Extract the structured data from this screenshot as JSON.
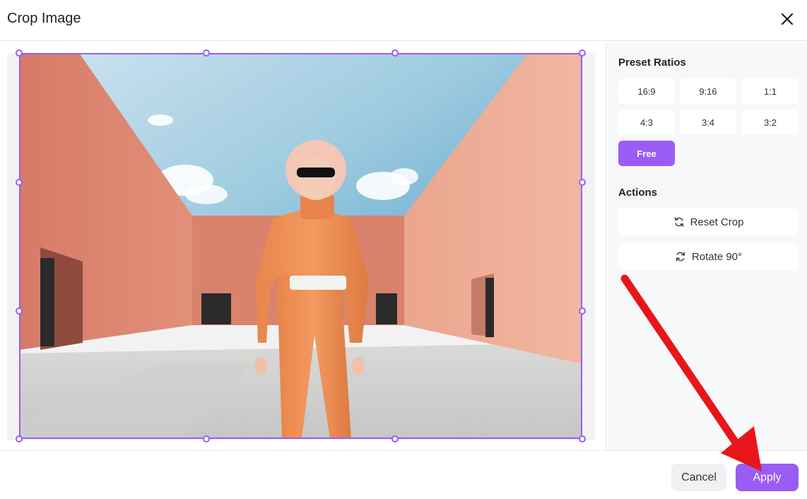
{
  "dialog": {
    "title": "Crop Image"
  },
  "sidebar": {
    "preset_title": "Preset Ratios",
    "ratios": [
      {
        "label": "16:9",
        "active": false
      },
      {
        "label": "9:16",
        "active": false
      },
      {
        "label": "1:1",
        "active": false
      },
      {
        "label": "4:3",
        "active": false
      },
      {
        "label": "3:4",
        "active": false
      },
      {
        "label": "3:2",
        "active": false
      },
      {
        "label": "Free",
        "active": true
      }
    ],
    "actions_title": "Actions",
    "reset_label": "Reset Crop",
    "rotate_label": "Rotate 90°"
  },
  "footer": {
    "cancel_label": "Cancel",
    "apply_label": "Apply"
  },
  "icons": {
    "close": "close-icon",
    "reset": "reset-icon",
    "rotate": "rotate-icon"
  },
  "colors": {
    "accent": "#9a5cf5",
    "annotation": "#e8161b"
  }
}
